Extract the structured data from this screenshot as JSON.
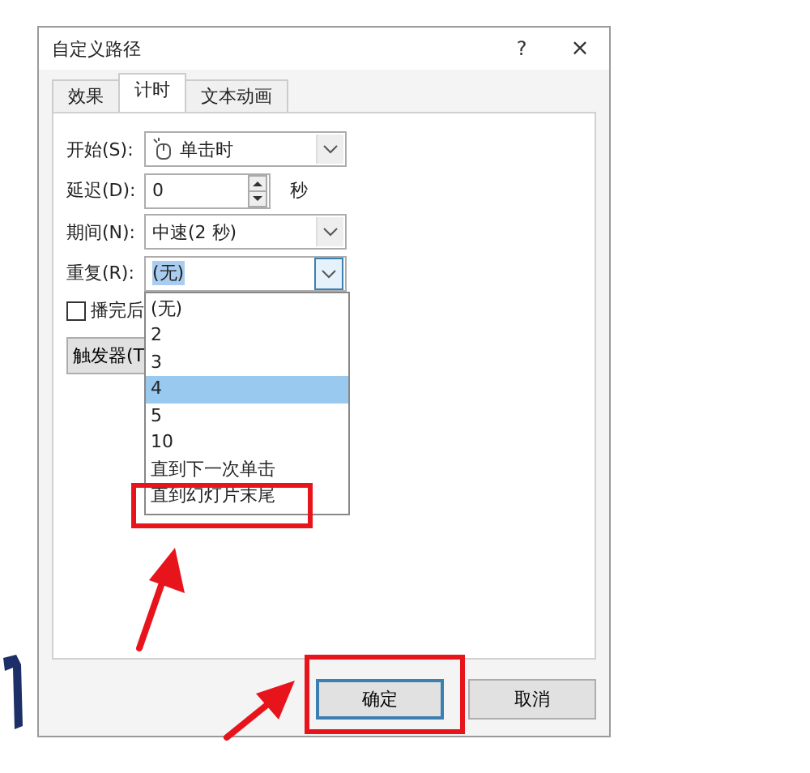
{
  "dialog": {
    "title": "自定义路径",
    "help": "?",
    "close": "×"
  },
  "tabs": [
    {
      "label": "效果",
      "selected": false
    },
    {
      "label": "计时",
      "selected": true
    },
    {
      "label": "文本动画",
      "selected": false
    }
  ],
  "fields": [
    {
      "kind": "iconcombo",
      "label": "开始(S):",
      "value": "单击时"
    },
    {
      "kind": "spin",
      "label": "延迟(D):",
      "value": "0",
      "unit": "秒"
    },
    {
      "kind": "combo",
      "label": "期间(N):",
      "value": "中速(2 秒)"
    },
    {
      "kind": "combo",
      "label": "重复(R):",
      "value": "(无)",
      "open": true
    }
  ],
  "checkbox": {
    "label": "播完后",
    "checked": false
  },
  "trigger_button": "触发器(T",
  "options": [
    {
      "label": "(无)",
      "selected": false
    },
    {
      "label": "2",
      "selected": false
    },
    {
      "label": "3",
      "selected": false
    },
    {
      "label": "4",
      "selected": true
    },
    {
      "label": "5",
      "selected": false
    },
    {
      "label": "10",
      "selected": false
    },
    {
      "label": "直到下一次单击",
      "selected": false
    },
    {
      "label": "直到幻灯片末尾",
      "selected": false
    }
  ],
  "buttons": [
    {
      "label": "确定",
      "default": true
    },
    {
      "label": "取消",
      "default": false
    }
  ]
}
